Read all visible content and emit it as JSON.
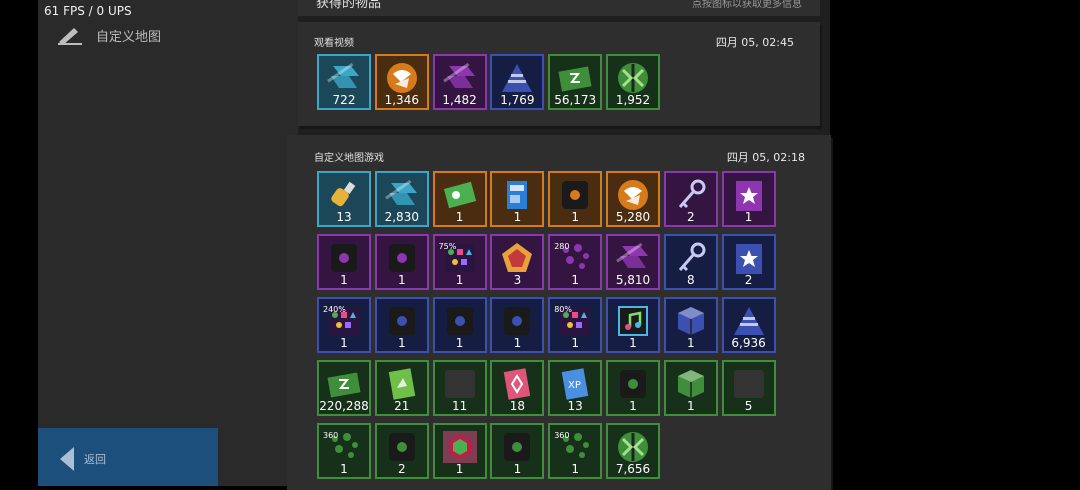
{
  "status": {
    "fps": "61 FPS / 0 UPS"
  },
  "sidebar": {
    "nav_label": "自定义地图",
    "back_label": "返回"
  },
  "header": {
    "title": "获得的物品",
    "hint": "点按图标以获取更多信息"
  },
  "colors": {
    "cyan": "#3aa7c8",
    "orange": "#d77a1a",
    "purple": "#8e35b0",
    "blue": "#3b50b0",
    "green": "#3f8f3a"
  },
  "panels": [
    {
      "title": "观看视频",
      "time": "四月 05, 02:45",
      "items": [
        {
          "rarity": "cyan",
          "icon": "stripes-icon",
          "count": "722"
        },
        {
          "rarity": "orange",
          "icon": "coin-icon",
          "count": "1,346"
        },
        {
          "rarity": "purple",
          "icon": "stripes-icon",
          "count": "1,482"
        },
        {
          "rarity": "blue",
          "icon": "triangle-icon",
          "count": "1,769"
        },
        {
          "rarity": "green",
          "icon": "cash-icon",
          "count": "56,173"
        },
        {
          "rarity": "green",
          "icon": "green-coin-icon",
          "count": "1,952"
        }
      ]
    },
    {
      "title": "自定义地图游戏",
      "time": "四月 05, 02:18",
      "items": [
        {
          "rarity": "cyan",
          "icon": "potion-icon",
          "count": "13"
        },
        {
          "rarity": "cyan",
          "icon": "stripes-icon",
          "count": "2,830"
        },
        {
          "rarity": "orange",
          "icon": "ticket-icon",
          "count": "1"
        },
        {
          "rarity": "orange",
          "icon": "card-icon",
          "count": "1"
        },
        {
          "rarity": "orange",
          "icon": "chip-icon",
          "count": "1"
        },
        {
          "rarity": "orange",
          "icon": "coin-icon",
          "count": "5,280"
        },
        {
          "rarity": "purple",
          "icon": "key-icon",
          "count": "2"
        },
        {
          "rarity": "purple",
          "icon": "star-banner-icon",
          "count": "1"
        },
        {
          "rarity": "purple",
          "icon": "chip-icon",
          "count": "1"
        },
        {
          "rarity": "purple",
          "icon": "chip-icon",
          "count": "1"
        },
        {
          "rarity": "purple",
          "icon": "shapes-icon",
          "count": "1",
          "badge": "75%"
        },
        {
          "rarity": "purple",
          "icon": "pentagon-icon",
          "count": "3"
        },
        {
          "rarity": "purple",
          "icon": "particles-icon",
          "count": "1",
          "badge": "280"
        },
        {
          "rarity": "purple",
          "icon": "stripes-icon",
          "count": "5,810"
        },
        {
          "rarity": "blue",
          "icon": "key-icon",
          "count": "8"
        },
        {
          "rarity": "blue",
          "icon": "star-banner-icon",
          "count": "2"
        },
        {
          "rarity": "blue",
          "icon": "shapes-icon",
          "count": "1",
          "badge": "240%"
        },
        {
          "rarity": "blue",
          "icon": "chip-icon",
          "count": "1"
        },
        {
          "rarity": "blue",
          "icon": "chip-icon",
          "count": "1"
        },
        {
          "rarity": "blue",
          "icon": "chip-icon",
          "count": "1"
        },
        {
          "rarity": "blue",
          "icon": "shapes-icon",
          "count": "1",
          "badge": "80%"
        },
        {
          "rarity": "blue",
          "icon": "music-icon",
          "count": "1"
        },
        {
          "rarity": "blue",
          "icon": "cube-icon",
          "count": "1"
        },
        {
          "rarity": "blue",
          "icon": "triangle-icon",
          "count": "6,936"
        },
        {
          "rarity": "green",
          "icon": "cash-icon",
          "count": "220,288"
        },
        {
          "rarity": "green",
          "icon": "banner-icon",
          "count": "21"
        },
        {
          "rarity": "green",
          "icon": "blank-icon",
          "count": "11"
        },
        {
          "rarity": "green",
          "icon": "pink-banner-icon",
          "count": "18"
        },
        {
          "rarity": "green",
          "icon": "xp-banner-icon",
          "count": "13"
        },
        {
          "rarity": "green",
          "icon": "chip-icon",
          "count": "1"
        },
        {
          "rarity": "green",
          "icon": "cube-icon",
          "count": "1"
        },
        {
          "rarity": "green",
          "icon": "blank-icon",
          "count": "5"
        },
        {
          "rarity": "green",
          "icon": "particles-icon",
          "count": "1",
          "badge": "360"
        },
        {
          "rarity": "green",
          "icon": "chip-icon",
          "count": "2"
        },
        {
          "rarity": "green",
          "icon": "hexagon-icon",
          "count": "1"
        },
        {
          "rarity": "green",
          "icon": "chip-icon",
          "count": "1"
        },
        {
          "rarity": "green",
          "icon": "particles-icon",
          "count": "1",
          "badge": "360"
        },
        {
          "rarity": "green",
          "icon": "green-coin-icon",
          "count": "7,656"
        }
      ]
    }
  ]
}
